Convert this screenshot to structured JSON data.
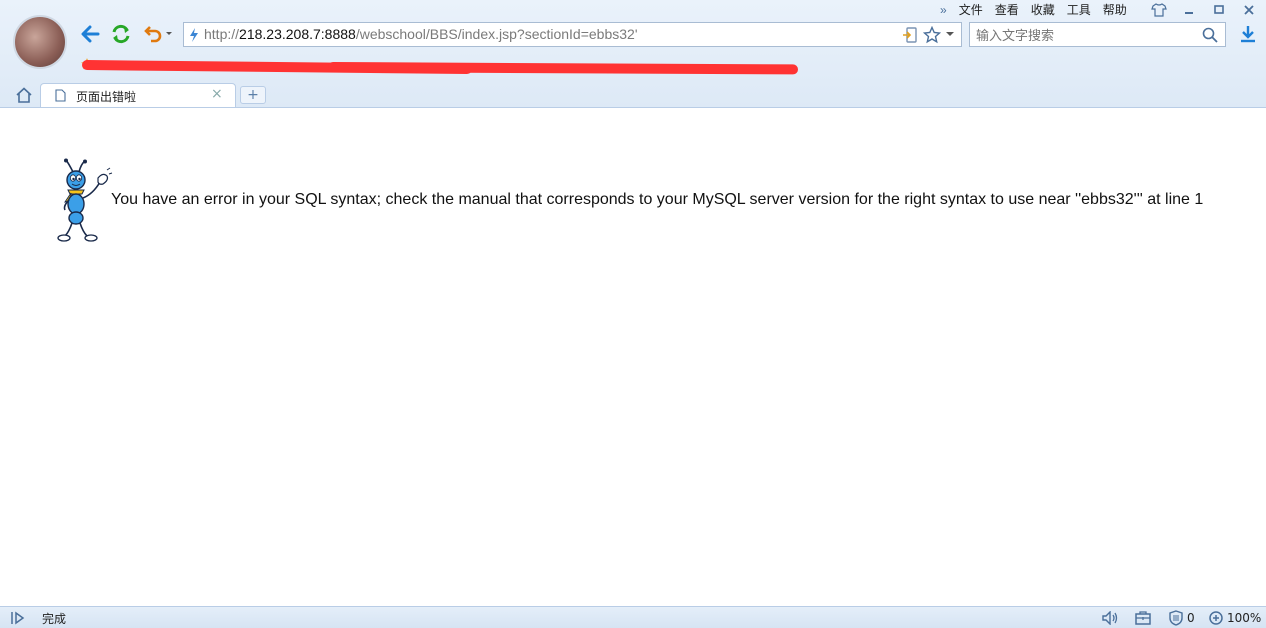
{
  "menu": {
    "items": [
      "文件",
      "查看",
      "收藏",
      "工具",
      "帮助"
    ]
  },
  "address": {
    "prefix": "http://",
    "host": "218.23.208.7:8888",
    "path": "/webschool/BBS/index.jsp?sectionId=ebbs32'"
  },
  "search": {
    "placeholder": "输入文字搜索"
  },
  "tab": {
    "title": "页面出错啦",
    "close": "×",
    "new_tab": "+"
  },
  "content": {
    "error_message": "You have an error in your SQL syntax; check the manual that corresponds to your MySQL server version for the right syntax to use near ''ebbs32''' at line 1"
  },
  "status": {
    "text": "完成",
    "shield_count": "0",
    "zoom": "100%"
  },
  "colors": {
    "accent": "#1e7fd6",
    "refresh": "#27a727",
    "undo": "#e07a10",
    "redaction": "#ff3333"
  }
}
